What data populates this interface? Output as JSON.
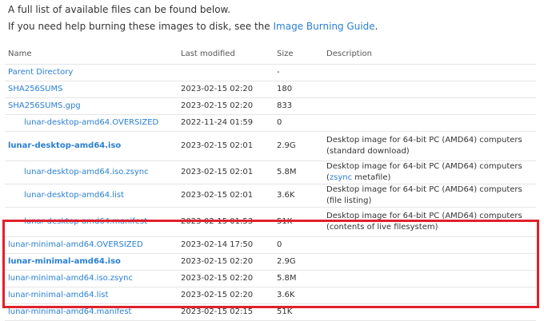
{
  "intro": {
    "line1": "A full list of available files can be found below.",
    "line2_prefix": "If you need help burning these images to disk, see the ",
    "line2_link": "Image Burning Guide",
    "line2_suffix": "."
  },
  "table": {
    "headers": [
      "Name",
      "Last modified",
      "Size",
      "Description"
    ],
    "rows": [
      {
        "name": "Parent Directory",
        "modified": "",
        "size": "-",
        "desc": ""
      },
      {
        "name": "SHA256SUMS",
        "modified": "2023-02-15 02:20",
        "size": "180",
        "desc": ""
      },
      {
        "name": "SHA256SUMS.gpg",
        "modified": "2023-02-15 02:20",
        "size": "833",
        "desc": ""
      },
      {
        "name": "lunar-desktop-amd64.OVERSIZED",
        "modified": "2022-11-24 01:59",
        "size": "0",
        "desc": ""
      },
      {
        "name": "lunar-desktop-amd64.iso",
        "modified": "2023-02-15 02:01",
        "size": "2.9G",
        "desc": "Desktop image for 64-bit PC (AMD64) computers (standard download)"
      },
      {
        "name": "lunar-desktop-amd64.iso.zsync",
        "modified": "2023-02-15 02:01",
        "size": "5.8M",
        "desc_prefix": "Desktop image for 64-bit PC (AMD64) computers (",
        "desc_link": "zsync",
        "desc_suffix": " metafile)"
      },
      {
        "name": "lunar-desktop-amd64.list",
        "modified": "2023-02-15 02:01",
        "size": "3.6K",
        "desc": "Desktop image for 64-bit PC (AMD64) computers (file listing)"
      },
      {
        "name": "lunar-desktop-amd64.manifest",
        "modified": "2023-02-15 01:53",
        "size": "51K",
        "desc": "Desktop image for 64-bit PC (AMD64) computers (contents of live filesystem)"
      },
      {
        "name": "lunar-minimal-amd64.OVERSIZED",
        "modified": "2023-02-14 17:50",
        "size": "0",
        "desc": ""
      },
      {
        "name": "lunar-minimal-amd64.iso",
        "modified": "2023-02-15 02:20",
        "size": "2.9G",
        "desc": ""
      },
      {
        "name": "lunar-minimal-amd64.iso.zsync",
        "modified": "2023-02-15 02:20",
        "size": "5.8M",
        "desc": ""
      },
      {
        "name": "lunar-minimal-amd64.list",
        "modified": "2023-02-15 02:20",
        "size": "3.6K",
        "desc": ""
      },
      {
        "name": "lunar-minimal-amd64.manifest",
        "modified": "2023-02-15 02:15",
        "size": "51K",
        "desc": ""
      }
    ]
  },
  "colors": {
    "link": "#2a7fd4",
    "highlight": "#e2202a"
  }
}
